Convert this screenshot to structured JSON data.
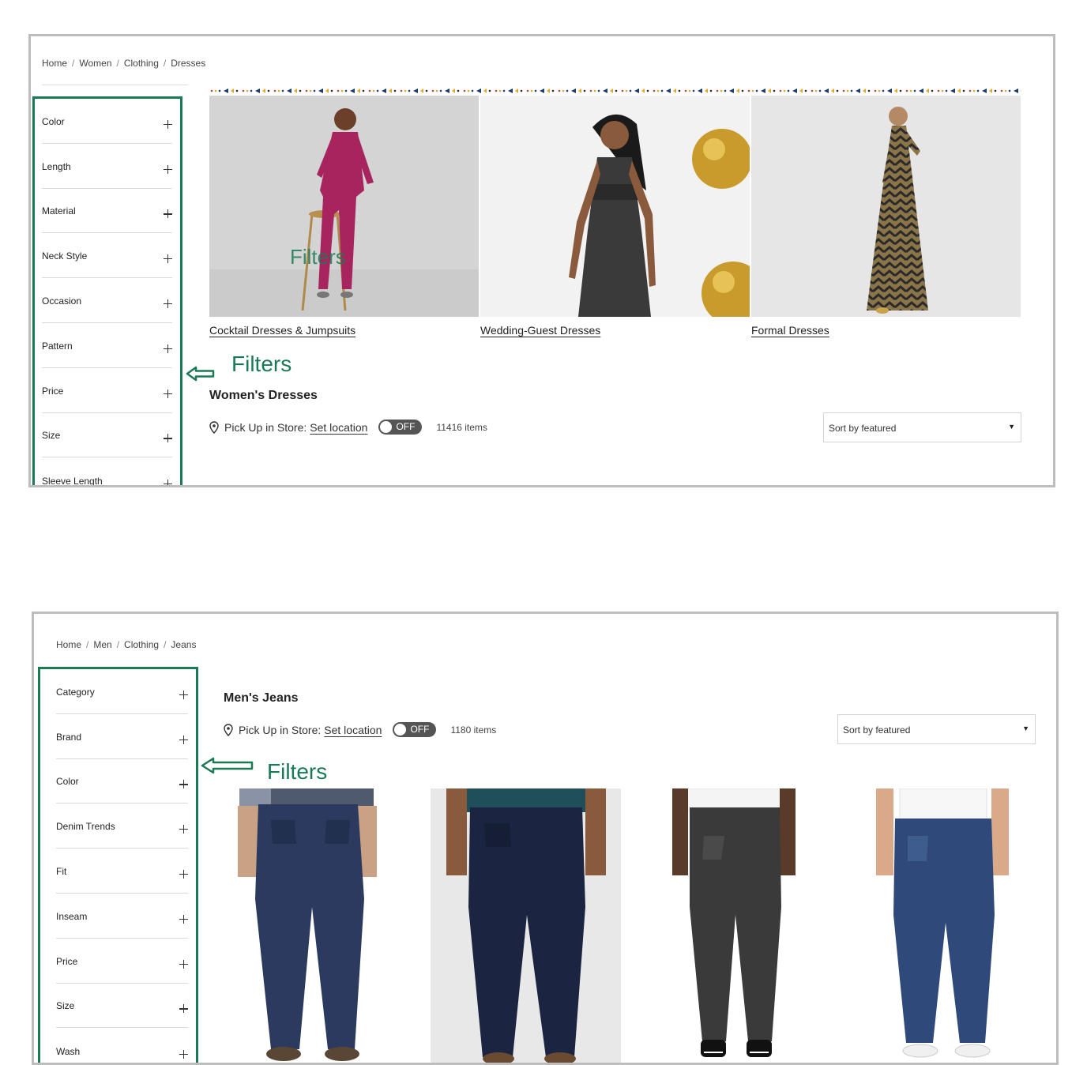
{
  "panels": [
    {
      "breadcrumb": [
        "Home",
        "Women",
        "Clothing",
        "Dresses"
      ],
      "filters": [
        "Color",
        "Length",
        "Material",
        "Neck Style",
        "Occasion",
        "Pattern",
        "Price",
        "Size",
        "Sleeve Length"
      ],
      "annotation": "Filters",
      "overlay_text": "Filters",
      "categories": [
        "Cocktail Dresses & Jumpsuits",
        "Wedding-Guest Dresses",
        "Formal Dresses"
      ],
      "title": "Women's Dresses",
      "pickup_label": "Pick Up in Store:",
      "set_location": "Set location",
      "toggle_state": "OFF",
      "item_count": "11416 items",
      "sort": "Sort by featured"
    },
    {
      "breadcrumb": [
        "Home",
        "Men",
        "Clothing",
        "Jeans"
      ],
      "filters": [
        "Category",
        "Brand",
        "Color",
        "Denim Trends",
        "Fit",
        "Inseam",
        "Price",
        "Size",
        "Wash"
      ],
      "annotation": "Filters",
      "title": "Men's Jeans",
      "pickup_label": "Pick Up in Store:",
      "set_location": "Set location",
      "toggle_state": "OFF",
      "item_count": "1180 items",
      "sort": "Sort by featured"
    }
  ],
  "colors": {
    "annotation_green": "#1a7a55",
    "panel_border": "#bdbdbd",
    "toggle_bg": "#555555"
  },
  "icons": [
    "plus-icon",
    "pin-icon",
    "caret-down-icon",
    "arrow-left-icon"
  ]
}
